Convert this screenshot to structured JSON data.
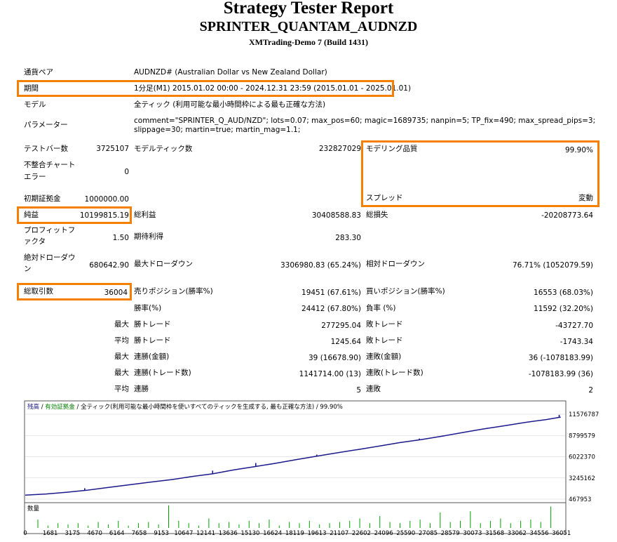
{
  "header": {
    "title": "Strategy Tester Report",
    "ea_name": "SPRINTER_QUANTAM_AUDNZD",
    "server": "XMTrading-Demo 7 (Build 1431)"
  },
  "info": {
    "symbol_label": "通貨ペア",
    "symbol_value": "AUDNZD# (Australian Dollar vs New Zealand Dollar)",
    "period_label": "期間",
    "period_value": "1分足(M1) 2015.01.02 00:00 - 2024.12.31 23:59 (2015.01.01 - 2025.01.01)",
    "model_label": "モデル",
    "model_value": "全ティック (利用可能な最小時間枠による最も正確な方法)",
    "params_label": "パラメーター",
    "params_line1": "comment=\"SPRINTER_Q_AUD/NZD\"; lots=0.07; max_pos=60; magic=1689735; nanpin=5; TP_fix=490; max_spread_pips=3;",
    "params_line2": "slippage=30; martin=true; martin_mag=1.1;"
  },
  "stats": {
    "bars_label": "テストバー数",
    "bars_value": "3725107",
    "ticks_label": "モデルティック数",
    "ticks_value": "232827029",
    "quality_label": "モデリング品質",
    "quality_value": "99.90%",
    "mismatch_label_1": "不整合チャート",
    "mismatch_label_2": "エラー",
    "mismatch_value": "0",
    "deposit_label": "初期証拠金",
    "deposit_value": "1000000.00",
    "spread_label": "スプレッド",
    "spread_value": "変動",
    "net_label": "純益",
    "net_value": "10199815.19",
    "gross_profit_label": "総利益",
    "gross_profit_value": "30408588.83",
    "gross_loss_label": "総損失",
    "gross_loss_value": "-20208773.64",
    "pf_label_1": "プロフィットフ",
    "pf_label_2": "ァクタ",
    "pf_value": "1.50",
    "expected_label": "期待利得",
    "expected_value": "283.30",
    "abs_dd_label_1": "絶対ドローダウ",
    "abs_dd_label_2": "ン",
    "abs_dd_value": "680642.90",
    "max_dd_label": "最大ドローダウン",
    "max_dd_value": "3306980.83 (65.24%)",
    "rel_dd_label": "相対ドローダウン",
    "rel_dd_value": "76.71% (1052079.59)",
    "trades_label": "総取引数",
    "trades_value": "36004",
    "short_label": "売りポジション(勝率%)",
    "short_value": "19451 (67.61%)",
    "long_label": "買いポジション(勝率%)",
    "long_value": "16553 (68.03%)",
    "win_rate_label": "勝率(%)",
    "win_rate_value": "24412 (67.80%)",
    "loss_rate_label": "負率 (%)",
    "loss_rate_value": "11592 (32.20%)",
    "max_word": "最大",
    "avg_word": "平均",
    "win_trade_label": "勝トレード",
    "loss_trade_label": "敗トレード",
    "max_win_value": "277295.04",
    "max_loss_value": "-43727.70",
    "avg_win_value": "1245.64",
    "avg_loss_value": "-1743.34",
    "cons_win_amt_label": "連勝(金額)",
    "cons_win_amt_value": "39 (16678.90)",
    "cons_loss_amt_label": "連敗(金額)",
    "cons_loss_amt_value": "36 (-1078183.99)",
    "cons_win_trd_label": "連勝(トレード数)",
    "cons_win_trd_value": "1141714.00 (13)",
    "cons_loss_trd_label": "連敗(トレード数)",
    "cons_loss_trd_value": "-1078183.99 (36)",
    "cons_wins_label": "連勝",
    "cons_wins_value": "5",
    "cons_losses_label": "連敗",
    "cons_losses_value": "2"
  },
  "chart_data": {
    "type": "line",
    "legend_balance": "残高",
    "legend_sep1": " / ",
    "legend_equity": "有効証拠金",
    "legend_rest": " / 全ティック(利用可能な最小時間枠を使いすべてのティックを生成する, 最も正確な方法) / 99.90%",
    "volume_label": "数量",
    "colors": {
      "balance": "#1a1a8c",
      "equity": "#008000",
      "volume": "#00a000",
      "grid": "#d0d0d0"
    },
    "y_ticks": [
      11576787,
      8799579,
      6022370,
      3245162,
      467953
    ],
    "ylim": [
      467953,
      11576787
    ],
    "x_ticks": [
      0,
      1681,
      3175,
      4670,
      6164,
      7658,
      9153,
      10647,
      12141,
      13636,
      15130,
      16624,
      18119,
      19613,
      21107,
      22602,
      24096,
      25590,
      27085,
      28579,
      30073,
      31568,
      33062,
      34556,
      36051
    ],
    "xlim": [
      0,
      36300
    ],
    "series": [
      {
        "values": [
          1000000,
          1150000,
          1380000,
          1650000,
          2010000,
          2350000,
          2700000,
          3010000,
          3420000,
          3780000,
          4290000,
          4720000,
          5150000,
          5640000,
          6090000,
          6540000,
          6970000,
          7410000,
          7870000,
          8240000,
          8690000,
          9180000,
          9650000,
          10060000,
          10500000,
          10870000,
          11200000
        ]
      }
    ],
    "balance_x": [
      0,
      1400,
      2800,
      4200,
      5600,
      7000,
      8400,
      9800,
      11200,
      12600,
      14000,
      15400,
      16800,
      18200,
      19600,
      21000,
      22400,
      23800,
      25200,
      26600,
      28000,
      29400,
      30800,
      32200,
      33600,
      35000,
      36004
    ],
    "spikes": [
      {
        "x": 4000,
        "v": 1900000
      },
      {
        "x": 12600,
        "v": 4200000
      },
      {
        "x": 15500,
        "v": 5200000
      },
      {
        "x": 19600,
        "v": 6300000
      },
      {
        "x": 26500,
        "v": 8400000
      },
      {
        "x": 31100,
        "v": 9800000
      },
      {
        "x": 34400,
        "v": 10750000
      },
      {
        "x": 35900,
        "v": 11500000
      }
    ],
    "volume": [
      0.35,
      0.1,
      0.2,
      0.15,
      0.2,
      0.1,
      0.25,
      0.15,
      0.3,
      0.1,
      0.2,
      0.25,
      0.15,
      0.95,
      0.3,
      0.2,
      0.1,
      0.4,
      0.2,
      0.25,
      0.15,
      0.3,
      0.2,
      0.35,
      0.1,
      0.25,
      0.2,
      0.3,
      0.15,
      0.2,
      0.25,
      0.3,
      0.4,
      0.2,
      0.5,
      0.25,
      0.2,
      0.3,
      0.35,
      0.2,
      0.65,
      0.25,
      0.3,
      0.7,
      0.2,
      0.3,
      0.4,
      0.2,
      0.3,
      0.35,
      0.25,
      0.9
    ]
  }
}
